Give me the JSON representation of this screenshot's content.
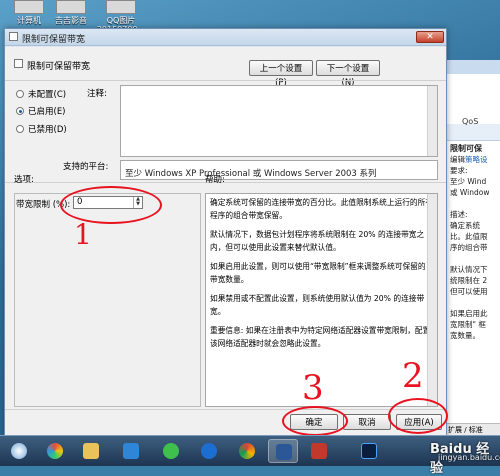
{
  "desktop": {
    "icons": [
      {
        "label": "计算机",
        "icon": "computer-icon"
      },
      {
        "label": "吉吉影音",
        "icon": "video-player-icon"
      },
      {
        "label": "QQ图片",
        "sub": "20150709...",
        "icon": "image-file-icon"
      }
    ]
  },
  "dialog": {
    "title": "限制可保留带宽",
    "policy_title": "限制可保留带宽",
    "prev_button": "上一个设置(P)",
    "next_button": "下一个设置(N)",
    "radios": [
      {
        "label": "未配置(C)",
        "checked": false
      },
      {
        "label": "已启用(E)",
        "checked": true
      },
      {
        "label": "已禁用(D)",
        "checked": false
      }
    ],
    "comment_label": "注释:",
    "platform_label": "支持的平台:",
    "platform_value": "至少 Windows XP Professional 或 Windows Server 2003 系列",
    "options_label": "选项:",
    "help_label": "帮助:",
    "bandwidth_label": "带宽限制 (%):",
    "bandwidth_value": "0",
    "help_paragraphs": [
      "确定系统可保留的连接带宽的百分比。此值限制系统上运行的所有程序的组合带宽保留。",
      "默认情况下，数据包计划程序将系统限制在 20% 的连接带宽之内，但可以使用此设置来替代默认值。",
      "如果启用此设置，则可以使用“带宽限制”框来调整系统可保留的带宽数量。",
      "如果禁用或不配置此设置，则系统使用默认值为 20% 的连接带宽。",
      "重要信息: 如果在注册表中为特定网络适配器设置带宽限制，配置该网络适配器时就会忽略此设置。"
    ],
    "ok_button": "确定",
    "cancel_button": "取消",
    "apply_button": "应用(A)"
  },
  "annotations": {
    "n1": "1",
    "n2": "2",
    "n3": "3",
    "color": "#e8131f"
  },
  "background_window": {
    "tab": "QoS",
    "heading": "限制可保",
    "edit_link_prefix": "编辑",
    "edit_link": "策略设",
    "lines": [
      "要求:",
      "至少 Wind",
      "或 Window",
      "",
      "描述:",
      "确定系统",
      "比。此值限",
      "序的组合带",
      "",
      "默认情况下",
      "统限制在 2",
      "但可以使用",
      "",
      "如果启用此",
      "宽限制\" 框",
      "宽数量。"
    ],
    "tabs": "扩展 / 标准"
  },
  "watermark": {
    "brand": "Baidu 经验",
    "url": "jingyan.baidu.com"
  }
}
